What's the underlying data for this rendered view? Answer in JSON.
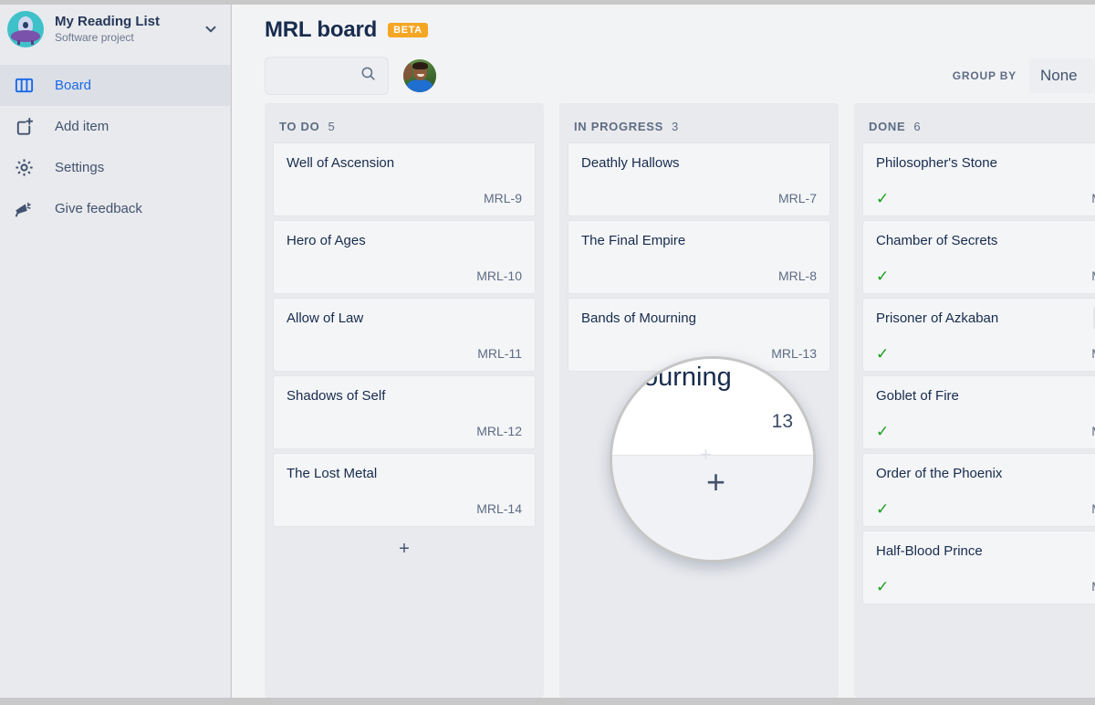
{
  "sidebar": {
    "project": {
      "name": "My Reading List",
      "subtitle": "Software project",
      "avatar_icon": "ufo-avatar-icon",
      "chevron_icon": "chevron-down-icon"
    },
    "items": [
      {
        "label": "Board",
        "icon": "board-columns-icon",
        "active": true
      },
      {
        "label": "Add item",
        "icon": "add-item-icon",
        "active": false
      },
      {
        "label": "Settings",
        "icon": "gear-icon",
        "active": false
      },
      {
        "label": "Give feedback",
        "icon": "megaphone-icon",
        "active": false
      }
    ]
  },
  "header": {
    "title": "MRL board",
    "badge": "BETA"
  },
  "toolbar": {
    "search": {
      "value": "",
      "placeholder": "",
      "icon": "search-icon"
    },
    "avatar": {
      "icon": "user-avatar-photo"
    },
    "group_by_label": "GROUP BY",
    "group_by_value": "None"
  },
  "board": {
    "columns": [
      {
        "name": "TO DO",
        "count": "5",
        "add_label": "+",
        "cards": [
          {
            "title": "Well of Ascension",
            "key": "MRL-9",
            "done": false
          },
          {
            "title": "Hero of Ages",
            "key": "MRL-10",
            "done": false
          },
          {
            "title": "Allow of Law",
            "key": "MRL-11",
            "done": false
          },
          {
            "title": "Shadows of Self",
            "key": "MRL-12",
            "done": false
          },
          {
            "title": "The Lost Metal",
            "key": "MRL-14",
            "done": false
          }
        ]
      },
      {
        "name": "IN PROGRESS",
        "count": "3",
        "add_label": "+",
        "cards": [
          {
            "title": "Deathly Hallows",
            "key": "MRL-7",
            "done": false
          },
          {
            "title": "The Final Empire",
            "key": "MRL-8",
            "done": false
          },
          {
            "title": "Bands of Mourning",
            "key": "MRL-13",
            "done": false
          }
        ]
      },
      {
        "name": "DONE",
        "count": "6",
        "add_label": "+",
        "cards": [
          {
            "title": "Philosopher's Stone",
            "key": "MR",
            "done": true,
            "check": "✓"
          },
          {
            "title": "Chamber of Secrets",
            "key": "MR",
            "done": true,
            "check": "✓"
          },
          {
            "title": "Prisoner of Azkaban",
            "key": "MR",
            "done": true,
            "check": "✓",
            "hovered": true
          },
          {
            "title": "Goblet of Fire",
            "key": "MR",
            "done": true,
            "check": "✓"
          },
          {
            "title": "Order of the Phoenix",
            "key": "MR",
            "done": true,
            "check": "✓"
          },
          {
            "title": "Half-Blood Prince",
            "key": "MR",
            "done": true,
            "check": "✓"
          }
        ]
      }
    ]
  },
  "magnifier": {
    "magnified_word": "ourning",
    "magnified_key": "13",
    "magnified_plus": "+",
    "magnified_ghost_plus": "+"
  },
  "colors": {
    "accent_blue": "#1a6ae8",
    "badge_orange": "#f5a623",
    "done_green": "#17a01c",
    "text_dark": "#172b4d",
    "text_muted": "#5e6c84",
    "column_bg": "#e9eaee",
    "card_bg": "#f4f5f7",
    "board_bg": "#f2f3f5"
  }
}
